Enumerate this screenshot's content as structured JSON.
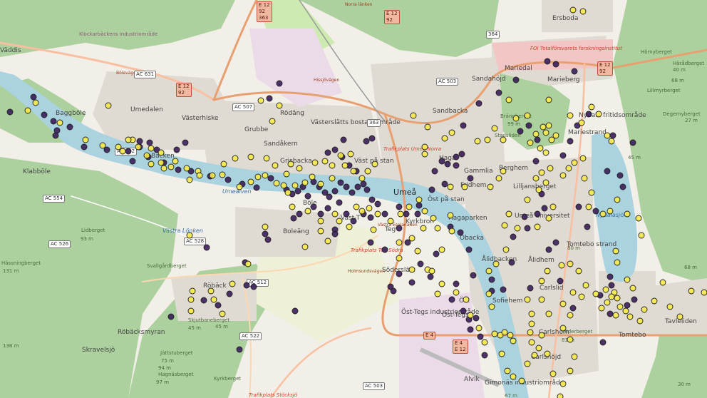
{
  "map": {
    "places": [
      {
        "name": "Ersboda",
        "kind": "dist"
      },
      {
        "name": "Mariedal",
        "kind": "dist"
      },
      {
        "name": "Sandahöjd",
        "kind": "dist"
      },
      {
        "name": "Marieberg",
        "kind": "dist"
      },
      {
        "name": "Sandbacka",
        "kind": "dist"
      },
      {
        "name": "Umedalen",
        "kind": "dist"
      },
      {
        "name": "Västerhiske",
        "kind": "dist"
      },
      {
        "name": "Baggböle",
        "kind": "dist"
      },
      {
        "name": "Grubbe",
        "kind": "dist"
      },
      {
        "name": "Rödäng",
        "kind": "dist"
      },
      {
        "name": "Västerslätts bostadsområde",
        "kind": "dist"
      },
      {
        "name": "Sandåkern",
        "kind": "dist"
      },
      {
        "name": "Grisbacka",
        "kind": "dist"
      },
      {
        "name": "Väst på stan",
        "kind": "dist"
      },
      {
        "name": "Umeå",
        "kind": "town"
      },
      {
        "name": "Öst på stan",
        "kind": "dist"
      },
      {
        "name": "Berghem",
        "kind": "dist"
      },
      {
        "name": "Fridhem",
        "kind": "dist"
      },
      {
        "name": "Lilljansberget",
        "kind": "dist"
      },
      {
        "name": "Mariestrand",
        "kind": "dist"
      },
      {
        "name": "Nydala fritidsområde",
        "kind": "dist"
      },
      {
        "name": "Klabböle",
        "kind": "dist"
      },
      {
        "name": "Backen",
        "kind": "dist"
      },
      {
        "name": "Böle",
        "kind": "dist"
      },
      {
        "name": "Väst-T",
        "kind": "dist"
      },
      {
        "name": "Teg",
        "kind": "dist"
      },
      {
        "name": "Boleäng",
        "kind": "dist"
      },
      {
        "name": "Ålidbacken",
        "kind": "dist"
      },
      {
        "name": "Öbacka",
        "kind": "dist"
      },
      {
        "name": "Tomtebo strand",
        "kind": "dist"
      },
      {
        "name": "Ålidhem",
        "kind": "dist"
      },
      {
        "name": "Carlslid",
        "kind": "dist"
      },
      {
        "name": "Sofiehem",
        "kind": "dist"
      },
      {
        "name": "Carlshem",
        "kind": "dist"
      },
      {
        "name": "Carlshöjd",
        "kind": "dist"
      },
      {
        "name": "Tavleliden",
        "kind": "dist"
      },
      {
        "name": "Röbäck",
        "kind": "dist"
      },
      {
        "name": "Söderslätt",
        "kind": "dist"
      },
      {
        "name": "Öst-Tegs industriområde",
        "kind": "dist"
      },
      {
        "name": "Röbäcksmyran",
        "kind": "dist"
      },
      {
        "name": "Skravelsjö",
        "kind": "dist"
      },
      {
        "name": "Alvik",
        "kind": "dist"
      },
      {
        "name": "Gimonäs industriområde",
        "kind": "dist"
      },
      {
        "name": "Klockarbäckens industriområde",
        "kind": "ind"
      },
      {
        "name": "Väddis",
        "kind": "dist"
      },
      {
        "name": "Hörnyberget",
        "kind": "peak"
      },
      {
        "name": "Härådberget",
        "kind": "peak"
      },
      {
        "name": "Degernyberget",
        "kind": "peak"
      },
      {
        "name": "Lillmyrberget",
        "kind": "peak"
      },
      {
        "name": "Hässningberget",
        "kind": "peak"
      },
      {
        "name": "Svallgårdberget",
        "kind": "peak"
      },
      {
        "name": "Lidberget",
        "kind": "peak"
      },
      {
        "name": "Skjutbaneberget",
        "kind": "peak"
      },
      {
        "name": "Jättstuberget",
        "kind": "peak"
      },
      {
        "name": "Hagnäsberget",
        "kind": "peak"
      },
      {
        "name": "Kyrkberget",
        "kind": "peak"
      },
      {
        "name": "Brännberget",
        "kind": "peak"
      },
      {
        "name": "Stadsliden",
        "kind": "peak"
      },
      {
        "name": "Söderberget",
        "kind": "peak"
      },
      {
        "name": "Nydalasjön",
        "kind": "water"
      },
      {
        "name": "Umeälven",
        "kind": "water"
      },
      {
        "name": "Västra Lönken",
        "kind": "water"
      },
      {
        "name": "Trafikplats Umeå Norra",
        "kind": "red"
      },
      {
        "name": "Trafikplats Teg Södra",
        "kind": "red"
      },
      {
        "name": "Norra länken",
        "kind": "road"
      },
      {
        "name": "Västra Esplanaden",
        "kind": "road"
      },
      {
        "name": "Tomtebo",
        "kind": "dist"
      },
      {
        "name": "Umeå universitet",
        "kind": "dist"
      },
      {
        "name": "Öst-Tegs",
        "kind": "dist"
      },
      {
        "name": "FOI Totalförsvarets forskningsinstitut",
        "kind": "red"
      },
      {
        "name": "Hagaparken",
        "kind": "dist"
      },
      {
        "name": "Haga",
        "kind": "dist"
      },
      {
        "name": "Gammlia",
        "kind": "dist"
      },
      {
        "name": "Kyrkbron",
        "kind": "dist"
      },
      {
        "name": "Ö...",
        "kind": "dist"
      },
      {
        "name": "Trafikplats Stöcksjö",
        "kind": "red"
      },
      {
        "name": "Hissjövägen",
        "kind": "road"
      },
      {
        "name": "Bölevägen",
        "kind": "road"
      },
      {
        "name": "Holmsundsvägen",
        "kind": "road"
      }
    ],
    "elevations": [
      "93 m",
      "131 m",
      "138 m",
      "75 m",
      "97 m",
      "45 m",
      "81 m",
      "99 m",
      "68 m",
      "40 m",
      "45 m",
      "80 m",
      "68 m",
      "30 m",
      "27 m",
      "67 m",
      "94 m",
      "45 m"
    ],
    "shields": [
      {
        "id": "E12-92-363",
        "text": "E 12\n92\n363",
        "kind": "e"
      },
      {
        "id": "E12-92-east",
        "text": "E 12\n92",
        "kind": "e"
      },
      {
        "id": "E12-92-west",
        "text": "E 12\n92",
        "kind": "e"
      },
      {
        "id": "E12-92-ne",
        "text": "E 12\n92",
        "kind": "e"
      },
      {
        "id": "364",
        "text": "364",
        "kind": "n"
      },
      {
        "id": "AC631",
        "text": "AC 631",
        "kind": "n"
      },
      {
        "id": "AC507",
        "text": "AC 507",
        "kind": "n"
      },
      {
        "id": "AC503-n",
        "text": "AC 503",
        "kind": "n"
      },
      {
        "id": "AC503-s",
        "text": "AC 503",
        "kind": "n"
      },
      {
        "id": "363",
        "text": "363",
        "kind": "n"
      },
      {
        "id": "AC554",
        "text": "AC 554",
        "kind": "n"
      },
      {
        "id": "AC526",
        "text": "AC 526",
        "kind": "n"
      },
      {
        "id": "AC528",
        "text": "AC 528",
        "kind": "n"
      },
      {
        "id": "AC512",
        "text": "AC 512",
        "kind": "n"
      },
      {
        "id": "AC522",
        "text": "AC 522",
        "kind": "n"
      },
      {
        "id": "AC532",
        "text": "AC 532",
        "kind": "n"
      },
      {
        "id": "E4-E12",
        "text": "E 4\nE 12",
        "kind": "e"
      },
      {
        "id": "E4",
        "text": "E 4",
        "kind": "e"
      }
    ],
    "colors": {
      "land": "#f2efe9",
      "forest": "#add19e",
      "forest_dark": "#9ec78b",
      "urban": "#e0dbd2",
      "water": "#aad3df",
      "residential": "#dcd7cf",
      "industrial": "#ebdbe8",
      "meadow": "#cdebb0",
      "road_main": "#f8c0a0",
      "road_trunk": "#e8a070",
      "marker_dark": "#3b1e5c",
      "marker_light": "#f5e94a",
      "marker_stroke": "#222222"
    },
    "markers": {
      "dark_count_label": "",
      "light_count_label": ""
    }
  }
}
